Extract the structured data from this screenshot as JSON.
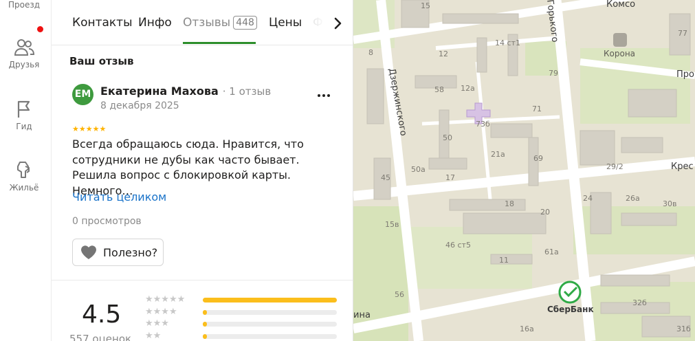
{
  "rail": {
    "items": [
      {
        "label": "Проезд",
        "icon": "route-icon"
      },
      {
        "label": "Друзья",
        "icon": "friends-icon"
      },
      {
        "label": "Гид",
        "icon": "flag-icon"
      },
      {
        "label": "Жильё",
        "icon": "housing-icon"
      }
    ]
  },
  "tabs": {
    "items": [
      {
        "label": "Контакты"
      },
      {
        "label": "Инфо"
      },
      {
        "label": "Отзывы",
        "badge": "448"
      },
      {
        "label": "Цены"
      },
      {
        "label": "Ф"
      }
    ],
    "active": "Отзывы"
  },
  "review": {
    "section_title": "Ваш отзыв",
    "avatar_initials": "ЕМ",
    "author": "Екатерина Махова",
    "author_reviews": "· 1 отзыв",
    "date": "8 декабря 2025",
    "stars": "★★★★★",
    "rating": 5,
    "text": "Всегда обращаюсь сюда. Нравится, что сотрудники не дубы как часто бывает. Решила вопрос с блокировкой карты. Немного…",
    "read_more": "Читать целиком",
    "views": "0 просмотров",
    "helpful": "Полезно?"
  },
  "summary": {
    "rating": "4.5",
    "count": "557 оценок",
    "distribution": [
      {
        "stars": "★★★★★",
        "fraction": 1.0
      },
      {
        "stars": "★★★★",
        "fraction": 0.03
      },
      {
        "stars": "★★★",
        "fraction": 0.03
      },
      {
        "stars": "★★",
        "fraction": 0.03
      }
    ]
  },
  "map": {
    "streets": [
      "Дзержинского",
      "Горького",
      "Комсо",
      "Про",
      "Крес",
      "ина"
    ],
    "pois": [
      "Корона",
      "СберБанк"
    ],
    "house_numbers": [
      "15",
      "12",
      "14 ст1",
      "8",
      "58",
      "12а",
      "79",
      "73б",
      "71",
      "50",
      "21а",
      "69",
      "29/2",
      "50а",
      "45",
      "17",
      "24",
      "26а",
      "30в",
      "18",
      "20",
      "15в",
      "46 ст5",
      "61а",
      "11",
      "56",
      "32б",
      "16а",
      "31б",
      "77"
    ]
  },
  "colors": {
    "accent_green": "#2c8e2a",
    "link_blue": "#1a73c9",
    "star_yellow": "#ffb300",
    "notification_red": "#ee1111"
  }
}
